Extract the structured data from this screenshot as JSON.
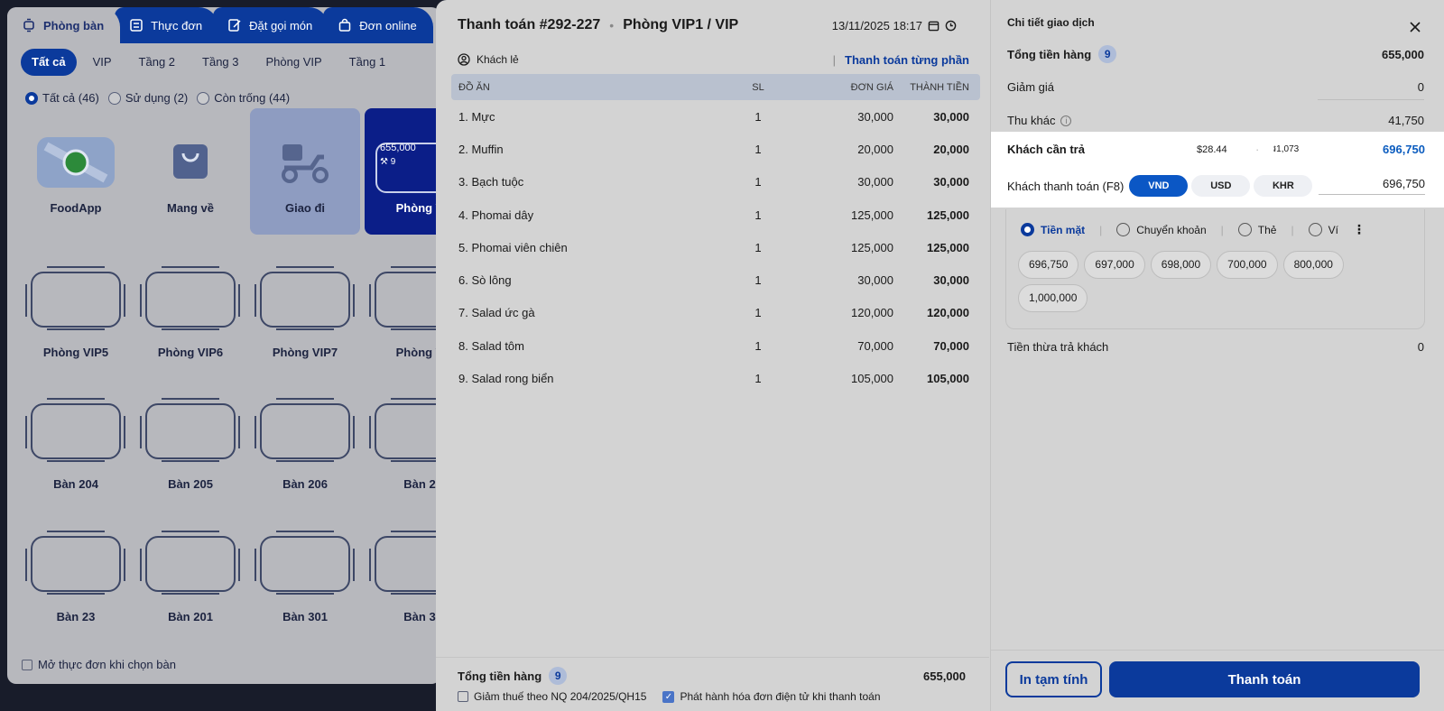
{
  "background": {
    "tabs": [
      {
        "label": "Phòng bàn",
        "icon": "floor-plan-icon",
        "active": true
      },
      {
        "label": "Thực đơn",
        "icon": "menu-book-icon",
        "active": false
      },
      {
        "label": "Đặt gọi món",
        "icon": "edit-order-icon",
        "active": false
      },
      {
        "label": "Đơn online",
        "icon": "shopping-bag-icon",
        "active": false
      }
    ],
    "filters": [
      "Tất cả",
      "VIP",
      "Tầng 2",
      "Tầng 3",
      "Phòng VIP",
      "Tầng 1"
    ],
    "status_filters": [
      "Tất cả (46)",
      "Sử dụng (2)",
      "Còn trống (44)"
    ],
    "tiles": [
      "FoodApp",
      "Mang về",
      "Giao đi",
      "Phòng V"
    ],
    "vip1_tile": {
      "amount": "655,000",
      "guests": "9"
    },
    "tables_row1": [
      "Phòng VIP5",
      "Phòng VIP6",
      "Phòng VIP7",
      "Phòng V"
    ],
    "tables_row2": [
      "Bàn 204",
      "Bàn 205",
      "Bàn 206",
      "Bàn 2"
    ],
    "tables_row3": [
      "Bàn 23",
      "Bàn 201",
      "Bàn 301",
      "Bàn 3"
    ],
    "open_menu_label": "Mở thực đơn khi chọn bàn"
  },
  "invoice": {
    "title": "Thanh toán #292-227",
    "room": "Phòng VIP1 / VIP",
    "datetime": "13/11/2025 18:17",
    "customer": "Khách lẻ",
    "split_payment": "Thanh toán từng phần",
    "columns": {
      "name": "ĐỒ ĂN",
      "qty": "SL",
      "price": "ĐƠN GIÁ",
      "total": "THÀNH TIỀN"
    },
    "items": [
      {
        "name": "1. Mực",
        "qty": "1",
        "price": "30,000",
        "total": "30,000"
      },
      {
        "name": "2. Muffin",
        "qty": "1",
        "price": "20,000",
        "total": "20,000"
      },
      {
        "name": "3. Bạch tuộc",
        "qty": "1",
        "price": "30,000",
        "total": "30,000"
      },
      {
        "name": "4. Phomai dây",
        "qty": "1",
        "price": "125,000",
        "total": "125,000"
      },
      {
        "name": "5. Phomai viên chiên",
        "qty": "1",
        "price": "125,000",
        "total": "125,000"
      },
      {
        "name": "6. Sò lông",
        "qty": "1",
        "price": "30,000",
        "total": "30,000"
      },
      {
        "name": "7. Salad ức gà",
        "qty": "1",
        "price": "120,000",
        "total": "120,000"
      },
      {
        "name": "8. Salad tôm",
        "qty": "1",
        "price": "70,000",
        "total": "70,000"
      },
      {
        "name": "9. Salad rong biển",
        "qty": "1",
        "price": "105,000",
        "total": "105,000"
      }
    ],
    "footer": {
      "total_label": "Tổng tiền hàng",
      "count": "9",
      "total": "655,000",
      "tax_reduction": "Giảm thuế theo NQ 204/2025/QH15",
      "e_invoice": "Phát hành hóa đơn điện tử khi thanh toán"
    }
  },
  "details": {
    "title": "Chi tiết giao dịch",
    "subtotal_label": "Tổng tiền hàng",
    "subtotal_count": "9",
    "subtotal": "655,000",
    "discount_label": "Giảm giá",
    "discount": "0",
    "other_label": "Thu khác",
    "other": "41,750",
    "due_label": "Khách cần trả",
    "due_usd": "$28.44",
    "due_khr": "៛1,073",
    "due": "696,750",
    "paid_label": "Khách thanh toán (F8)",
    "currencies": [
      "VND",
      "USD",
      "KHR"
    ],
    "paid": "696,750",
    "methods": [
      "Tiền mặt",
      "Chuyển khoản",
      "Thẻ",
      "Ví"
    ],
    "quick_amounts": [
      "696,750",
      "697,000",
      "698,000",
      "700,000",
      "800,000",
      "1,000,000"
    ],
    "change_label": "Tiền thừa trả khách",
    "change": "0",
    "print_button": "In tạm tính",
    "pay_button": "Thanh toán"
  }
}
